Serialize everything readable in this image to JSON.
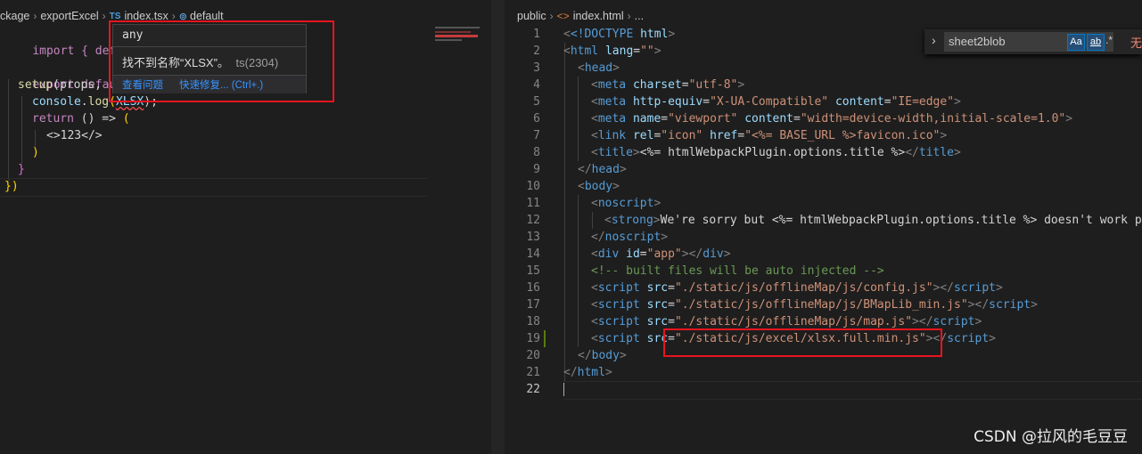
{
  "left": {
    "breadcrumb": {
      "b1": "ckage",
      "b2": "exportExcel",
      "ts": "TS",
      "file": "index.tsx",
      "symbol": "default"
    },
    "code": {
      "l1a": "import { defineC",
      "l2a": "export default ",
      "l3a": "setup",
      "l3b": "(props, ",
      "l4a": "console",
      "l4b": ".",
      "l4c": "log",
      "l4d": "XLSX",
      "l4e": ");",
      "l5a": "return",
      "l5b": " () => ",
      "l6": "<>123</>",
      "l7": ")",
      "l8": "}",
      "l9": "})"
    },
    "hover": {
      "type": "any",
      "message": "找不到名称“XLSX”。",
      "code": "ts(2304)",
      "link1": "查看问题",
      "link2": "快速修复... (Ctrl+.)"
    }
  },
  "right": {
    "breadcrumb": {
      "b1": "public",
      "file": "index.html",
      "rest": "..."
    },
    "find": {
      "query": "sheet2blob",
      "aa": "Aa",
      "ab": "ab",
      "re": ".*",
      "result": "无"
    },
    "line_numbers": [
      "1",
      "2",
      "3",
      "4",
      "5",
      "6",
      "7",
      "8",
      "9",
      "10",
      "11",
      "12",
      "13",
      "14",
      "15",
      "16",
      "17",
      "18",
      "19",
      "20",
      "21",
      "22"
    ],
    "code": {
      "c1a": "<!DOCTYPE ",
      "c1b": "html",
      "c2a": "html",
      "c2b": "lang",
      "c2c": "\"\"",
      "c3": "head",
      "c4a": "meta",
      "c4b": "charset",
      "c4c": "\"utf-8\"",
      "c5a": "meta",
      "c5b": "http-equiv",
      "c5c": "\"X-UA-Compatible\"",
      "c5d": "content",
      "c5e": "\"IE=edge\"",
      "c6a": "meta",
      "c6b": "name",
      "c6c": "\"viewport\"",
      "c6d": "content",
      "c6e": "\"width=device-width,initial-scale=1.0\"",
      "c7a": "link",
      "c7b": "rel",
      "c7c": "\"icon\"",
      "c7d": "href",
      "c7e": "\"<%= BASE_URL %>favicon.ico\"",
      "c8a": "title",
      "c8b": "<%= htmlWebpackPlugin.options.title %>",
      "c8c": "title",
      "c9": "head",
      "c10": "body",
      "c11": "noscript",
      "c12a": "strong",
      "c12b": "We're sorry but <%= htmlWebpackPlugin.options.title %> doesn't work pro",
      "c13": "noscript",
      "c14a": "div",
      "c14b": "id",
      "c14c": "\"app\"",
      "c14d": "div",
      "c15": "<!-- built files will be auto injected -->",
      "c16a": "script",
      "c16b": "src",
      "c16c": "\"./static/js/offlineMap/js/config.js\"",
      "c16d": "script",
      "c17a": "script",
      "c17b": "src",
      "c17c": "\"./static/js/offlineMap/js/BMapLib_min.js\"",
      "c17d": "script",
      "c18a": "script",
      "c18b": "src",
      "c18c": "\"./static/js/offlineMap/js/map.js\"",
      "c18d": "script",
      "c19a": "script",
      "c19b": "src",
      "c19c": "\"./static/js/excel/xlsx.full.min.js\"",
      "c19d": "script",
      "c20": "body",
      "c21": "html"
    }
  },
  "watermark": "CSDN @拉风的毛豆豆",
  "colors": {
    "annotation": "#e8141e",
    "link": "#3794ff"
  }
}
